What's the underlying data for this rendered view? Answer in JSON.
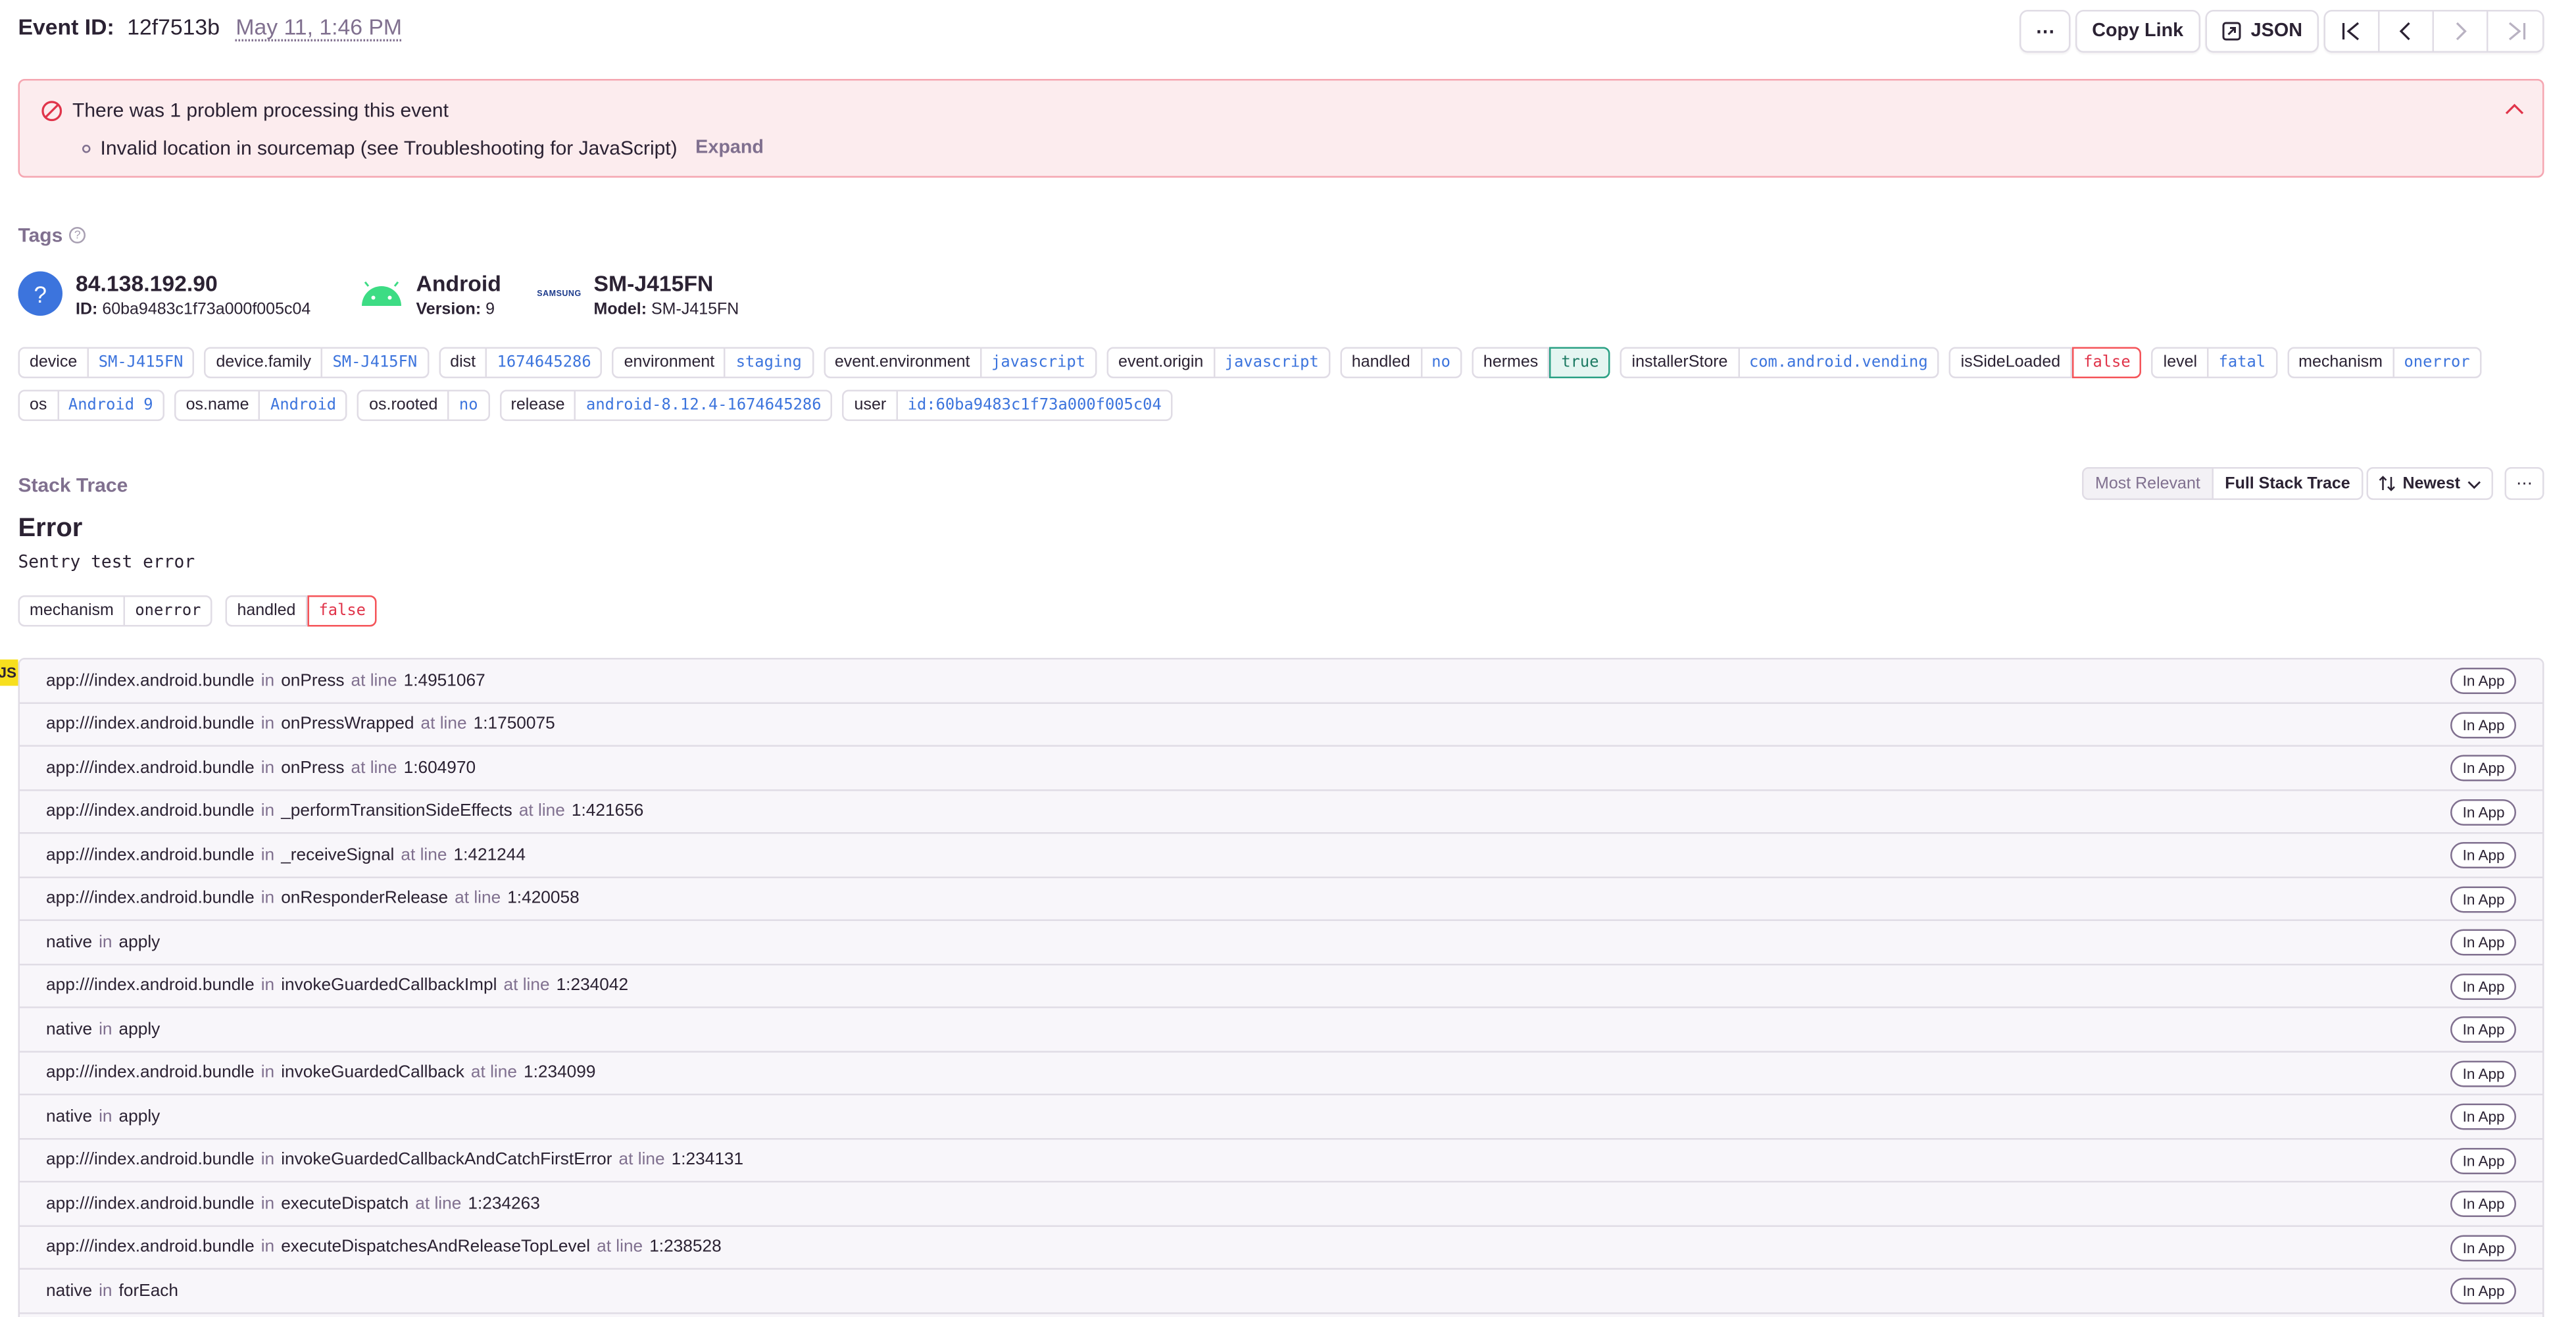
{
  "header": {
    "event_label": "Event ID:",
    "event_id": "12f7513b",
    "date": "May 11, 1:46 PM",
    "more_label": "⋯",
    "copy_link_label": "Copy Link",
    "json_label": "JSON"
  },
  "alert": {
    "title": "There was 1 problem processing this event",
    "item": "Invalid location in sourcemap (see Troubleshooting for JavaScript)",
    "expand_label": "Expand"
  },
  "tags": {
    "title": "Tags",
    "help_icon": "?",
    "user": {
      "title": "84.138.192.90",
      "id_label": "ID:",
      "id_value": "60ba9483c1f73a000f005c04",
      "avatar_glyph": "?"
    },
    "os": {
      "title": "Android",
      "version_label": "Version:",
      "version_value": "9"
    },
    "device": {
      "logo_text": "SAMSUNG",
      "title": "SM-J415FN",
      "model_label": "Model:",
      "model_value": "SM-J415FN"
    },
    "row1": [
      {
        "key": "device",
        "value": "SM-J415FN",
        "style": ""
      },
      {
        "key": "device.family",
        "value": "SM-J415FN",
        "style": ""
      },
      {
        "key": "dist",
        "value": "1674645286",
        "style": ""
      },
      {
        "key": "environment",
        "value": "staging",
        "style": ""
      },
      {
        "key": "event.environment",
        "value": "javascript",
        "style": ""
      },
      {
        "key": "event.origin",
        "value": "javascript",
        "style": ""
      },
      {
        "key": "handled",
        "value": "no",
        "style": ""
      },
      {
        "key": "hermes",
        "value": "true",
        "style": "green"
      },
      {
        "key": "installerStore",
        "value": "com.android.vending",
        "style": ""
      },
      {
        "key": "isSideLoaded",
        "value": "false",
        "style": "red"
      },
      {
        "key": "level",
        "value": "fatal",
        "style": ""
      },
      {
        "key": "mechanism",
        "value": "onerror",
        "style": ""
      }
    ],
    "row2": [
      {
        "key": "os",
        "value": "Android 9",
        "style": ""
      },
      {
        "key": "os.name",
        "value": "Android",
        "style": ""
      },
      {
        "key": "os.rooted",
        "value": "no",
        "style": ""
      },
      {
        "key": "release",
        "value": "android-8.12.4-1674645286",
        "style": ""
      },
      {
        "key": "user",
        "value": "id:60ba9483c1f73a000f005c04",
        "style": ""
      }
    ]
  },
  "stack": {
    "title": "Stack Trace",
    "most_relevant_label": "Most Relevant",
    "full_trace_label": "Full Stack Trace",
    "sort_label": "Newest",
    "more_label": "⋯",
    "error_type": "Error",
    "error_value": "Sentry test error",
    "mechanism_pills": [
      {
        "key": "mechanism",
        "value": "onerror",
        "style": "dark"
      },
      {
        "key": "handled",
        "value": "false",
        "style": "red"
      }
    ],
    "platform_badge": "JS",
    "in_label": "in",
    "at_line_label": "at line",
    "frames": [
      {
        "file": "app:///index.android.bundle",
        "func": "onPress",
        "line": "1:4951067",
        "badge": "In App"
      },
      {
        "file": "app:///index.android.bundle",
        "func": "onPressWrapped",
        "line": "1:1750075",
        "badge": "In App"
      },
      {
        "file": "app:///index.android.bundle",
        "func": "onPress",
        "line": "1:604970",
        "badge": "In App"
      },
      {
        "file": "app:///index.android.bundle",
        "func": "_performTransitionSideEffects",
        "line": "1:421656",
        "badge": "In App"
      },
      {
        "file": "app:///index.android.bundle",
        "func": "_receiveSignal",
        "line": "1:421244",
        "badge": "In App"
      },
      {
        "file": "app:///index.android.bundle",
        "func": "onResponderRelease",
        "line": "1:420058",
        "badge": "In App"
      },
      {
        "file": "native",
        "func": "apply",
        "line": "",
        "badge": "In App"
      },
      {
        "file": "app:///index.android.bundle",
        "func": "invokeGuardedCallbackImpl",
        "line": "1:234042",
        "badge": "In App"
      },
      {
        "file": "native",
        "func": "apply",
        "line": "",
        "badge": "In App"
      },
      {
        "file": "app:///index.android.bundle",
        "func": "invokeGuardedCallback",
        "line": "1:234099",
        "badge": "In App"
      },
      {
        "file": "native",
        "func": "apply",
        "line": "",
        "badge": "In App"
      },
      {
        "file": "app:///index.android.bundle",
        "func": "invokeGuardedCallbackAndCatchFirstError",
        "line": "1:234131",
        "badge": "In App"
      },
      {
        "file": "app:///index.android.bundle",
        "func": "executeDispatch",
        "line": "1:234263",
        "badge": "In App"
      },
      {
        "file": "app:///index.android.bundle",
        "func": "executeDispatchesAndReleaseTopLevel",
        "line": "1:238528",
        "badge": "In App"
      },
      {
        "file": "native",
        "func": "forEach",
        "line": "",
        "badge": "In App"
      },
      {
        "file": "",
        "func": "",
        "line": "",
        "badge": ""
      }
    ]
  },
  "colors": {
    "text": "#2b2233",
    "muted": "#80708f",
    "link_blue": "#3c74dd",
    "alert_bg": "#fcecee",
    "alert_border": "#f5a6b1",
    "success": "#2ba185",
    "danger": "#e0344a",
    "android_green": "#3ddc84"
  }
}
